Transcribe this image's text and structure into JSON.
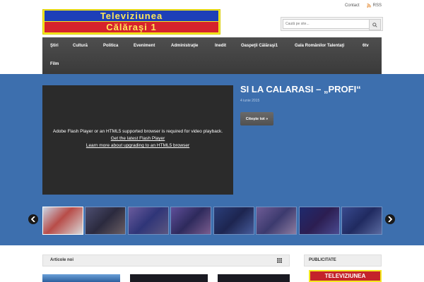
{
  "header": {
    "top_links": {
      "contact": "Contact",
      "rss": "RSS"
    },
    "logo": {
      "line1": "Televiziunea",
      "line2": "Călăraşi 1"
    },
    "search": {
      "placeholder": "Caută pe site..."
    }
  },
  "nav": {
    "items": [
      "Ştiri",
      "Cultură",
      "Politica",
      "Eveniment",
      "Administraţie",
      "Inedit",
      "Oaspeţii Călăraşi1",
      "Gala Românilor Talentaţi",
      "6tv",
      "Film"
    ]
  },
  "hero": {
    "post_title": "SI LA CALARASI – „PROFI“",
    "post_date": "4 iunie 2015",
    "read_more": "Citește tot »",
    "video_message": "Adobe Flash Player or an HTML5 supported browser is required for video playback.",
    "video_link1": "Get the latest Flash Player",
    "video_link2": "Learn more about upgrading to an HTML5 browser"
  },
  "colors": {
    "hero_bg": "#3d6fae",
    "nav_bg": "#474747",
    "logo_yellow": "#f4e820",
    "logo_blue": "#1d3fb8",
    "logo_red": "#d6232c"
  },
  "content": {
    "recent_label": "Articole noi",
    "widget_title": "PUBLICITATE",
    "ad_text": "TELEVIZIUNEA"
  },
  "thumbnails": 8
}
